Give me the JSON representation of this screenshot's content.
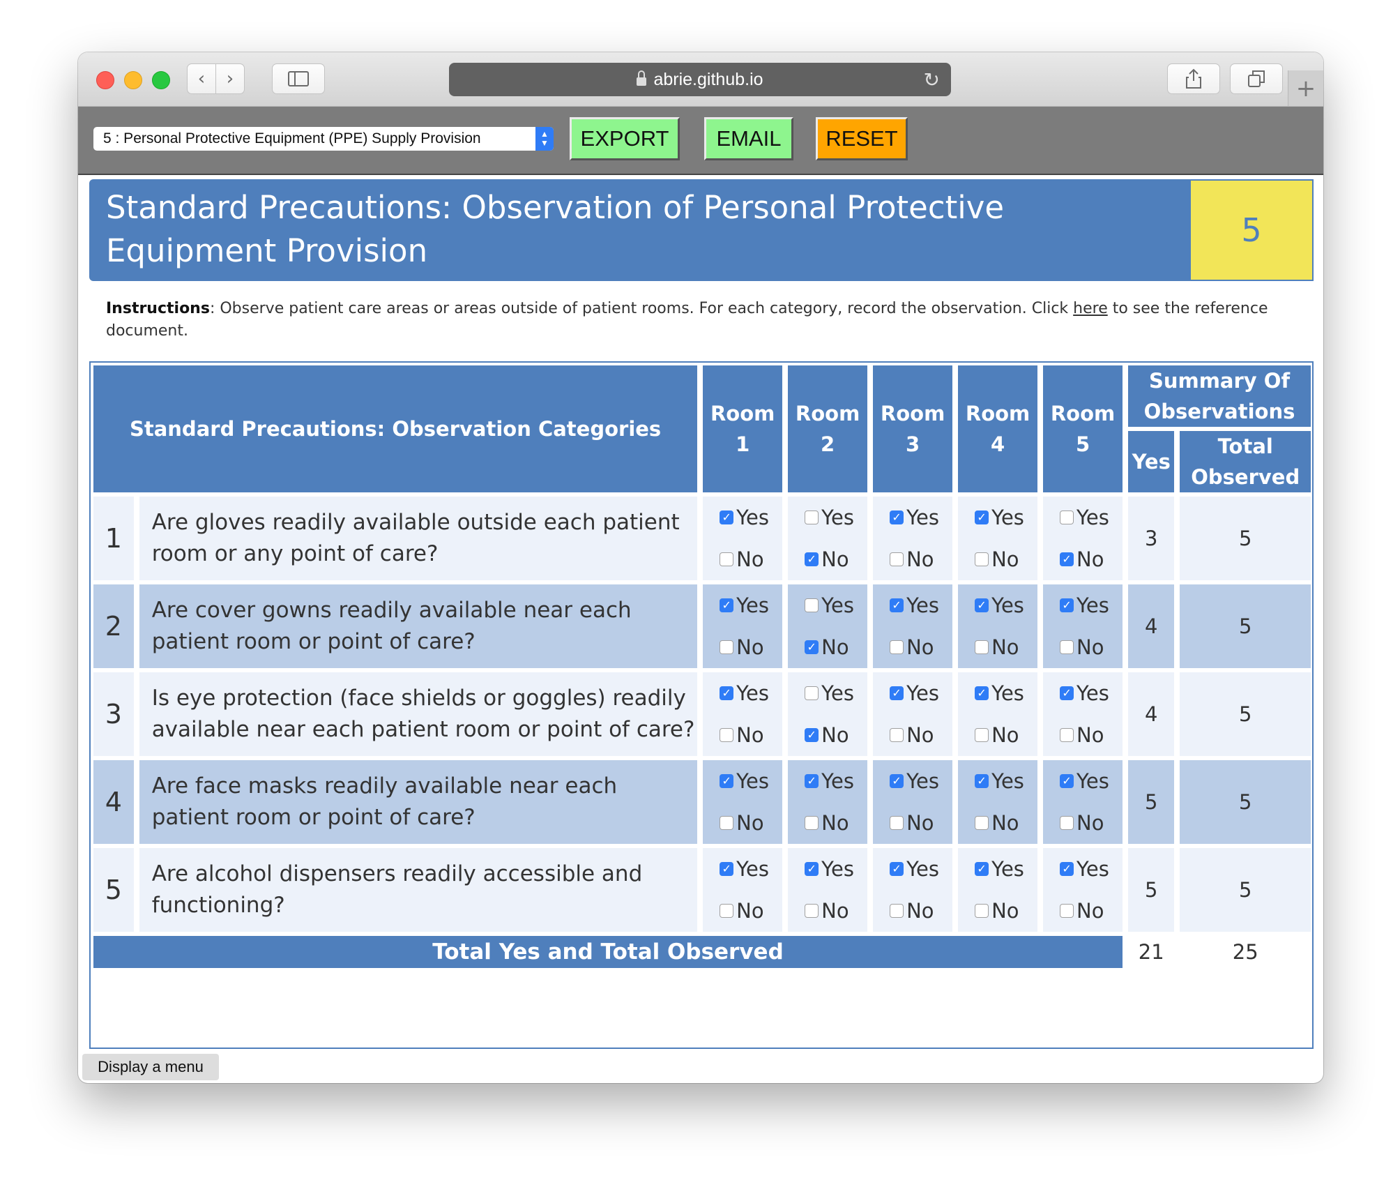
{
  "browser": {
    "url": "abrie.github.io"
  },
  "toolbar": {
    "select_value": "5 : Personal Protective Equipment (PPE) Supply Provision",
    "export_label": "EXPORT",
    "email_label": "EMAIL",
    "reset_label": "RESET",
    "colors": {
      "export": "#8ef58e",
      "email": "#8ef58e",
      "reset": "#ffa500"
    }
  },
  "header": {
    "title": "Standard Precautions: Observation of Personal Protective Equipment Provision",
    "badge": "5",
    "colors": {
      "banner": "#4f7fbc",
      "badge": "#f2e558"
    }
  },
  "instructions": {
    "label": "Instructions",
    "text_before": ": Observe patient care areas or areas outside of patient rooms. For each category, record the observation. Click ",
    "link": "here",
    "text_after": " to see the reference document."
  },
  "table": {
    "category_header": "Standard Precautions: Observation Categories",
    "rooms": [
      "Room 1",
      "Room 2",
      "Room 3",
      "Room 4",
      "Room 5"
    ],
    "summary_header": "Summary Of Observations",
    "yes_header": "Yes",
    "total_header": "Total Observed",
    "yes_label": "Yes",
    "no_label": "No",
    "rows": [
      {
        "num": "1",
        "question": "Are gloves readily available outside each patient room or any point of care?",
        "answers": [
          "Yes",
          "No",
          "Yes",
          "Yes",
          "No"
        ],
        "yes": "3",
        "total": "5"
      },
      {
        "num": "2",
        "question": "Are cover gowns readily available near each patient room or point of care?",
        "answers": [
          "Yes",
          "No",
          "Yes",
          "Yes",
          "Yes"
        ],
        "yes": "4",
        "total": "5"
      },
      {
        "num": "3",
        "question": "Is eye protection (face shields or goggles) readily available near each patient room or point of care?",
        "answers": [
          "Yes",
          "No",
          "Yes",
          "Yes",
          "Yes"
        ],
        "yes": "4",
        "total": "5"
      },
      {
        "num": "4",
        "question": "Are face masks readily available near each patient room or point of care?",
        "answers": [
          "Yes",
          "Yes",
          "Yes",
          "Yes",
          "Yes"
        ],
        "yes": "5",
        "total": "5"
      },
      {
        "num": "5",
        "question": "Are alcohol dispensers readily accessible and functioning?",
        "answers": [
          "Yes",
          "Yes",
          "Yes",
          "Yes",
          "Yes"
        ],
        "yes": "5",
        "total": "5"
      }
    ],
    "footer_label": "Total Yes and Total Observed",
    "footer_yes": "21",
    "footer_total": "25"
  },
  "menu_button": "Display a menu"
}
